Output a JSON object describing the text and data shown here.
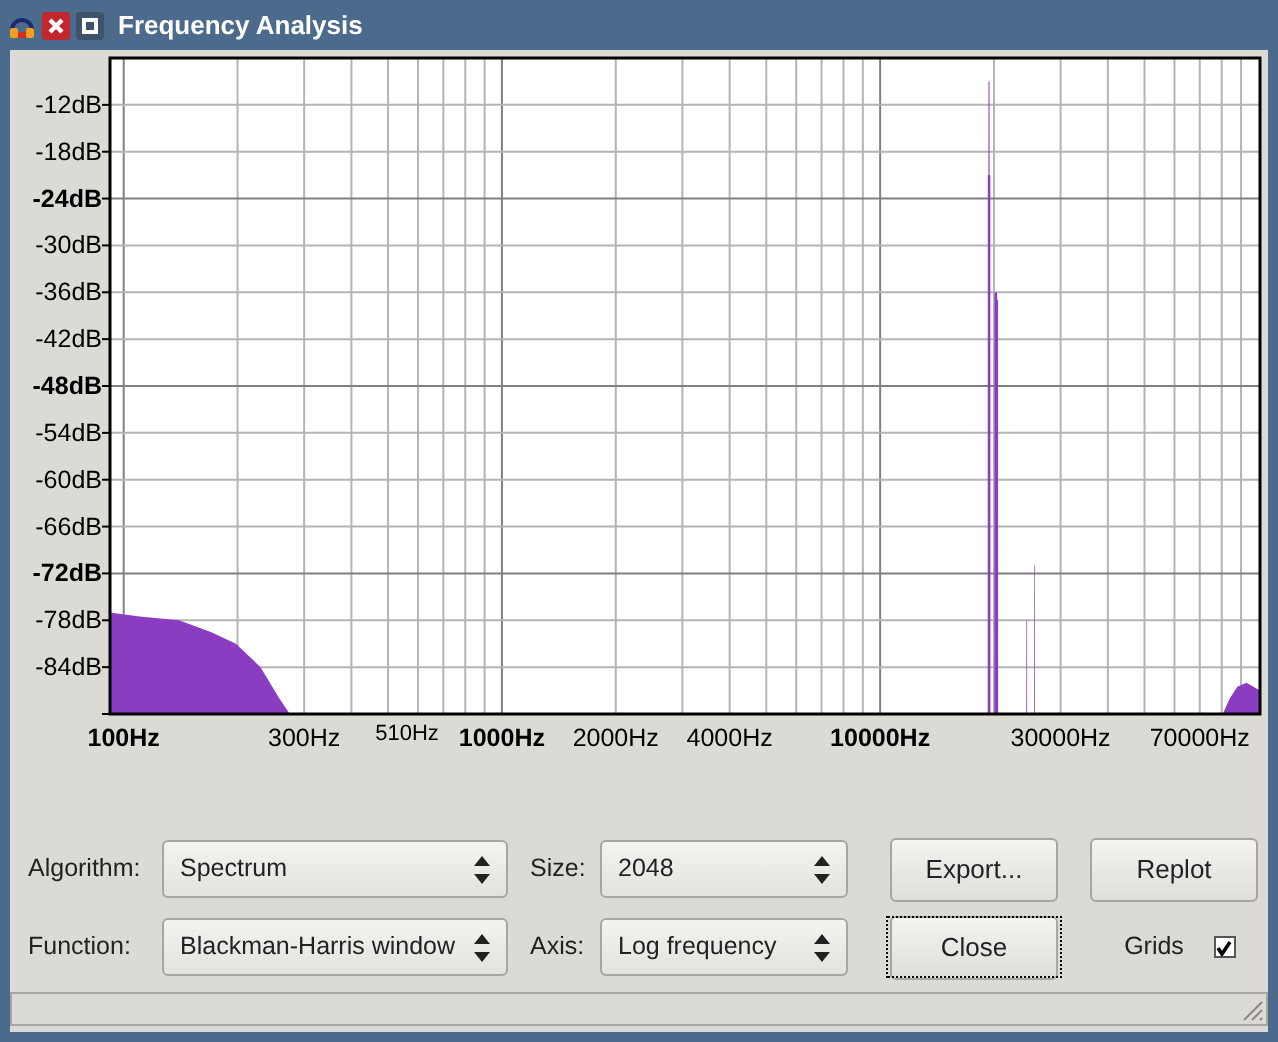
{
  "window": {
    "title": "Frequency Analysis"
  },
  "plot": {
    "kind": "spectrum",
    "y_labels": [
      {
        "text": "-12dB",
        "emphasized": false
      },
      {
        "text": "-18dB",
        "emphasized": false
      },
      {
        "text": "-24dB",
        "emphasized": true
      },
      {
        "text": "-30dB",
        "emphasized": false
      },
      {
        "text": "-36dB",
        "emphasized": false
      },
      {
        "text": "-42dB",
        "emphasized": false
      },
      {
        "text": "-48dB",
        "emphasized": true
      },
      {
        "text": "-54dB",
        "emphasized": false
      },
      {
        "text": "-60dB",
        "emphasized": false
      },
      {
        "text": "-66dB",
        "emphasized": false
      },
      {
        "text": "-72dB",
        "emphasized": true
      },
      {
        "text": "-78dB",
        "emphasized": false
      },
      {
        "text": "-84dB",
        "emphasized": false
      }
    ],
    "x_labels": [
      {
        "text": "100Hz",
        "emphasized": true
      },
      {
        "text": "300Hz",
        "emphasized": false
      },
      {
        "text": "1000Hz",
        "emphasized": true
      },
      {
        "text": "2000Hz",
        "emphasized": false
      },
      {
        "text": "4000Hz",
        "emphasized": false
      },
      {
        "text": "10000Hz",
        "emphasized": true
      },
      {
        "text": "30000Hz",
        "emphasized": false
      },
      {
        "text": "70000Hz",
        "emphasized": false
      }
    ],
    "marker_label": "510Hz"
  },
  "rows": [
    {
      "fields": [
        {
          "label": "Algorithm:",
          "value": "Spectrum"
        },
        {
          "label": "Size:",
          "value": "2048"
        }
      ],
      "button": {
        "label": "Export...",
        "focused": false
      },
      "extra": {
        "kind": "button",
        "label": "Replot",
        "focused": false
      }
    },
    {
      "fields": [
        {
          "label": "Function:",
          "value": "Blackman-Harris window"
        },
        {
          "label": "Axis:",
          "value": "Log frequency"
        }
      ],
      "button": {
        "label": "Close",
        "focused": true
      },
      "extra": {
        "kind": "checkbox",
        "label": "Grids",
        "checked": true
      }
    }
  ]
}
